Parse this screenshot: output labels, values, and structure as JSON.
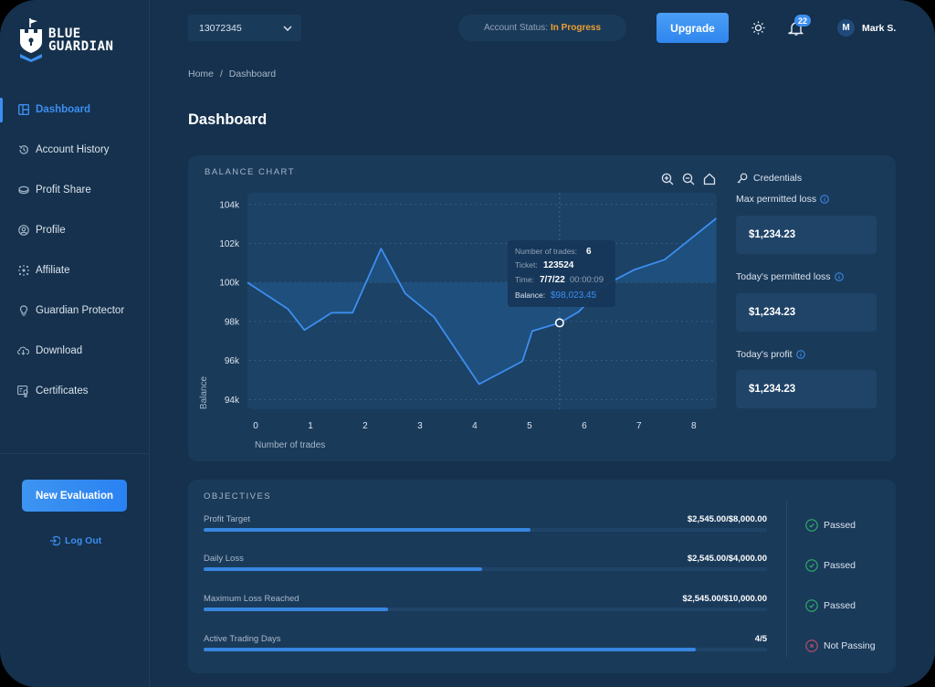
{
  "brand": {
    "line1": "BLUE",
    "line2": "GUARDIAN"
  },
  "sidebar": {
    "items": [
      {
        "label": "Dashboard",
        "icon": "layout-icon",
        "active": true
      },
      {
        "label": "Account History",
        "icon": "history-icon"
      },
      {
        "label": "Profit Share",
        "icon": "coin-icon"
      },
      {
        "label": "Profile",
        "icon": "user-circle-icon"
      },
      {
        "label": "Affiliate",
        "icon": "network-icon"
      },
      {
        "label": "Guardian Protector",
        "icon": "bulb-icon"
      },
      {
        "label": "Download",
        "icon": "cloud-download-icon"
      },
      {
        "label": "Certificates",
        "icon": "certificate-icon"
      }
    ],
    "new_evaluation": "New Evaluation",
    "logout": "Log Out"
  },
  "header": {
    "account_number": "13072345",
    "status_label": "Account Status:",
    "status_value": "In Progress",
    "upgrade": "Upgrade",
    "notifications": "22",
    "avatar_initial": "M",
    "user_name": "Mark S."
  },
  "breadcrumb": {
    "home": "Home",
    "sep": "/",
    "current": "Dashboard"
  },
  "page_title": "Dashboard",
  "balance_chart": {
    "title": "BALANCE CHART",
    "tooltip": {
      "trades_label": "Number of trades:",
      "trades_value": "6",
      "ticket_label": "Ticket:",
      "ticket_value": "123524",
      "time_label": "Time:",
      "time_date": "7/7/22",
      "time_clock": "00:00:09",
      "balance_label": "Balance:",
      "balance_value": "$98,023.45"
    }
  },
  "chart_data": {
    "type": "area",
    "title": "BALANCE CHART",
    "xlabel": "Number of trades",
    "ylabel": "Balance",
    "x_ticks": [
      0,
      1,
      2,
      3,
      4,
      5,
      6,
      7,
      8
    ],
    "y_ticks": [
      94000,
      96000,
      98000,
      100000,
      102000,
      104000
    ],
    "y_tick_labels": [
      "94k",
      "96k",
      "98k",
      "100k",
      "102k",
      "104k"
    ],
    "xlim": [
      -0.15,
      8.42
    ],
    "ylim": [
      93500,
      104600
    ],
    "baseline": 100000,
    "grid": true,
    "series": [
      {
        "name": "Balance",
        "color": "#3d8ef0",
        "x": [
          -0.15,
          0.59,
          0.89,
          1.39,
          1.77,
          2.29,
          2.73,
          3.26,
          4.08,
          4.87,
          5.05,
          5.55,
          5.9,
          6.34,
          6.92,
          7.47,
          8.41
        ],
        "y": [
          100000,
          98640,
          97560,
          98450,
          98450,
          101740,
          99440,
          98220,
          94790,
          95960,
          97510,
          97930,
          98500,
          99810,
          100660,
          101170,
          103290
        ]
      }
    ],
    "highlight": {
      "x": 5.55,
      "y": 97930
    }
  },
  "credentials": {
    "title": "Credentials",
    "stats": [
      {
        "label": "Max permitted loss",
        "value": "$1,234.23"
      },
      {
        "label": "Today's permitted loss",
        "value": "$1,234.23"
      },
      {
        "label": "Today's profit",
        "value": "$1,234.23"
      }
    ]
  },
  "objectives": {
    "title": "OBJECTIVES",
    "items": [
      {
        "label": "Profit Target",
        "value": "$2,545.00/$8,000.00",
        "progress": 0.58,
        "status": "Passed",
        "passed": true
      },
      {
        "label": "Daily Loss",
        "value": "$2,545.00/$4,000.00",
        "progress": 0.494,
        "status": "Passed",
        "passed": true
      },
      {
        "label": "Maximum Loss Reached",
        "value": "$2,545.00/$10,000.00",
        "progress": 0.328,
        "status": "Passed",
        "passed": true
      },
      {
        "label": "Active Trading Days",
        "value": "4/5",
        "progress": 0.873,
        "status": "Not Passing",
        "passed": false
      }
    ]
  },
  "colors": {
    "accent": "#3d8ef0",
    "status_in_progress": "#f0a030",
    "passed": "#2fb36b",
    "not_passing": "#c0506a"
  }
}
